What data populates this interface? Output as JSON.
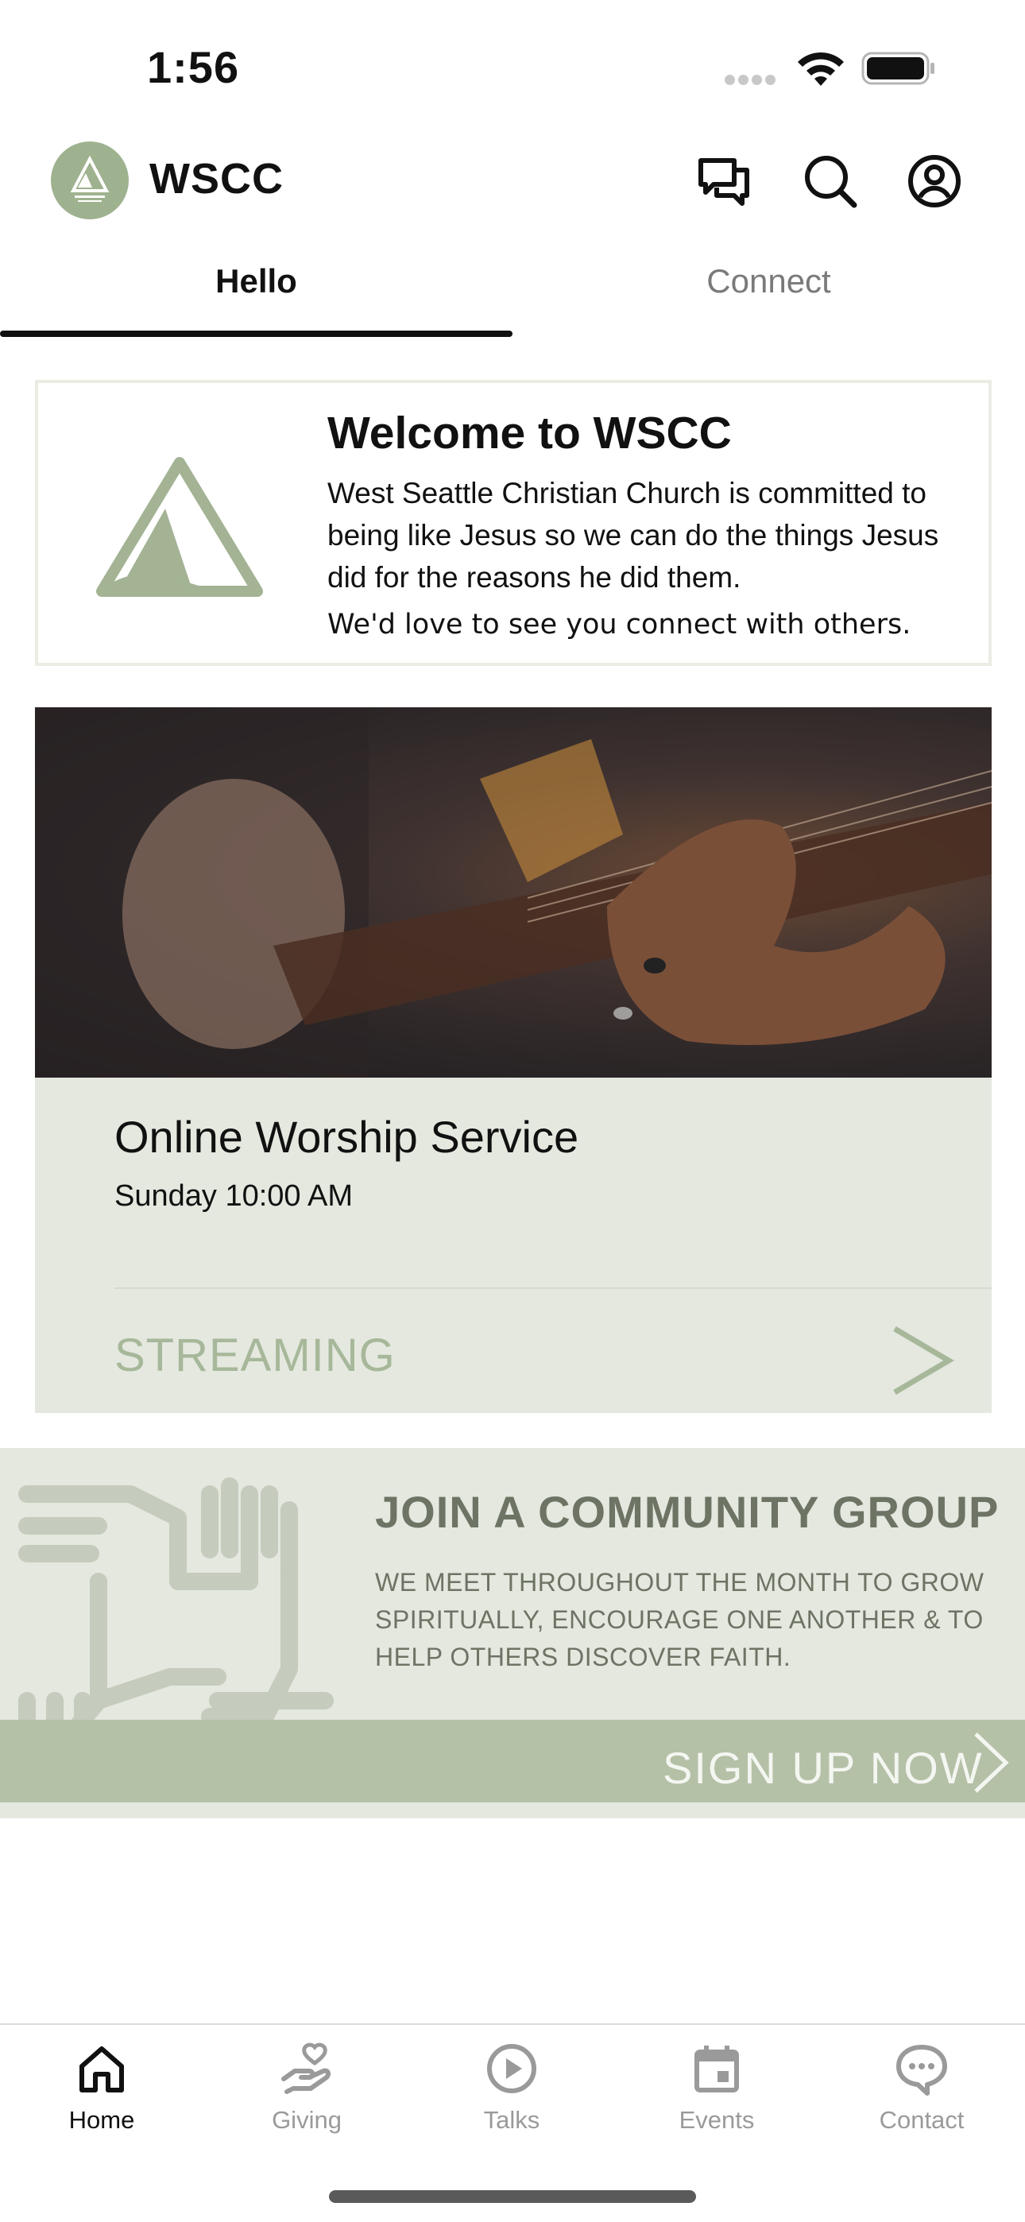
{
  "status_bar": {
    "time": "1:56"
  },
  "header": {
    "title": "WSCC",
    "icons": [
      "chat-bubbles-icon",
      "search-icon",
      "account-icon"
    ],
    "brand_color": "#9fb28f"
  },
  "tabs": [
    {
      "label": "Hello",
      "active": true
    },
    {
      "label": "Connect",
      "active": false
    }
  ],
  "welcome": {
    "title": "Welcome to WSCC",
    "body": "West Seattle Christian Church is committed to being like Jesus so we can do the things Jesus did for the reasons he did them.",
    "subtitle": "We'd love to see you connect with others."
  },
  "worship": {
    "title": "Online Worship Service",
    "time": "Sunday 10:00 AM",
    "action": "STREAMING"
  },
  "community": {
    "title": "JOIN A COMMUNITY GROUP",
    "description": "WE MEET THROUGHOUT THE MONTH TO GROW SPIRITUALLY, ENCOURAGE ONE ANOTHER & TO HELP OTHERS DISCOVER FAITH.",
    "action": "SIGN UP NOW"
  },
  "bottom_nav": [
    {
      "label": "Home",
      "icon": "home-icon",
      "active": true
    },
    {
      "label": "Giving",
      "icon": "giving-hand-heart-icon",
      "active": false
    },
    {
      "label": "Talks",
      "icon": "play-circle-icon",
      "active": false
    },
    {
      "label": "Events",
      "icon": "calendar-icon",
      "active": false
    },
    {
      "label": "Contact",
      "icon": "chat-bubble-dots-icon",
      "active": false
    }
  ]
}
